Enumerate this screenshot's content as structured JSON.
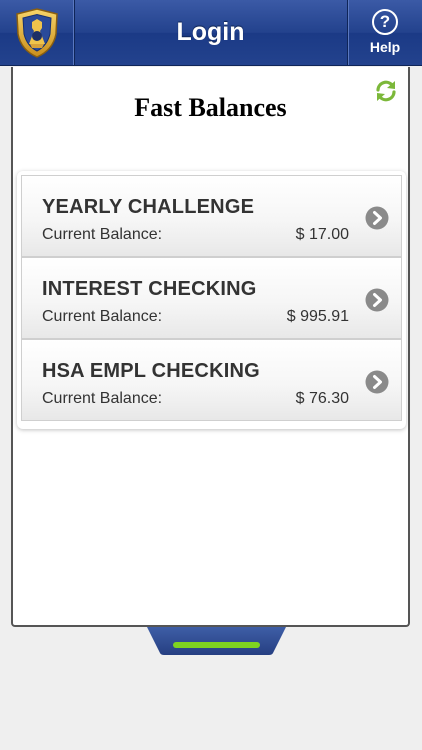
{
  "header": {
    "title": "Login",
    "help_icon_glyph": "?",
    "help_label": "Help",
    "logo_icon": "shield-logo-icon",
    "colors": {
      "bar": "#23428d",
      "shield_gold": "#e7b43a",
      "shield_blue": "#2a4a9a"
    }
  },
  "panel": {
    "title": "Fast Balances",
    "refresh_icon": "refresh-icon",
    "refresh_color": "#7cb83a"
  },
  "accounts": [
    {
      "name": "YEARLY CHALLENGE",
      "label": "Current Balance:",
      "balance": "$ 17.00"
    },
    {
      "name": "INTEREST CHECKING",
      "label": "Current Balance:",
      "balance": "$ 995.91"
    },
    {
      "name": "HSA EMPL CHECKING",
      "label": "Current Balance:",
      "balance": "$ 76.30"
    }
  ],
  "row_icon": "chevron-right-icon",
  "row_icon_color": "#8a8a8a",
  "bottom_tab": {
    "icon": "drawer-handle-icon",
    "tab_color": "#2f4f95",
    "handle_color": "#7ed321"
  }
}
